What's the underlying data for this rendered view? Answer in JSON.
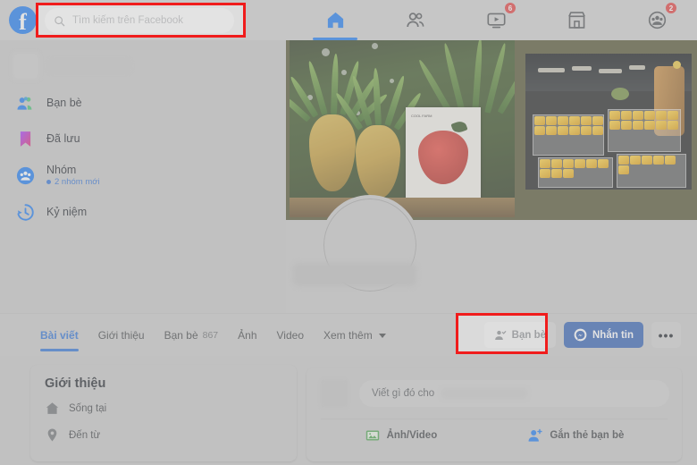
{
  "app": {
    "name": "Facebook",
    "logo_letter": "f",
    "brand_color": "#1877f2"
  },
  "topbar": {
    "search": {
      "placeholder": "Tìm kiếm trên Facebook",
      "value": "",
      "icon": "search-icon"
    },
    "nav": [
      {
        "name": "home",
        "icon": "home-icon",
        "active": true,
        "badge": ""
      },
      {
        "name": "friends",
        "icon": "friends-icon",
        "active": false,
        "badge": ""
      },
      {
        "name": "watch",
        "icon": "watch-icon",
        "active": false,
        "badge": "6"
      },
      {
        "name": "marketplace",
        "icon": "marketplace-icon",
        "active": false,
        "badge": ""
      },
      {
        "name": "groups",
        "icon": "groups-icon",
        "active": false,
        "badge": "2"
      }
    ]
  },
  "sidebar": {
    "profile": {
      "name_redacted": true
    },
    "items": [
      {
        "label": "Bạn bè",
        "icon": "friends-icon",
        "sub": ""
      },
      {
        "label": "Đã lưu",
        "icon": "bookmark-icon",
        "sub": ""
      },
      {
        "label": "Nhóm",
        "icon": "groups-icon",
        "sub": "2 nhóm mới"
      },
      {
        "label": "Kỷ niệm",
        "icon": "clock-icon",
        "sub": ""
      }
    ]
  },
  "cover": {
    "description": "Ảnh bìa"
  },
  "profile": {
    "name_redacted": true
  },
  "tabs": [
    {
      "label": "Bài viết",
      "count": "",
      "active": true
    },
    {
      "label": "Giới thiệu",
      "count": "",
      "active": false
    },
    {
      "label": "Bạn bè",
      "count": "867",
      "active": false
    },
    {
      "label": "Ảnh",
      "count": "",
      "active": false
    },
    {
      "label": "Video",
      "count": "",
      "active": false
    },
    {
      "label": "Xem thêm",
      "count": "",
      "active": false,
      "caret": true
    }
  ],
  "actions": {
    "friends_button": {
      "label": "Bạn bè",
      "icon": "person-check-icon"
    },
    "message_button": {
      "label": "Nhắn tin",
      "icon": "messenger-icon"
    },
    "more_button": {
      "label": "•••",
      "icon": "ellipsis-icon"
    }
  },
  "intro_card": {
    "title": "Giới thiệu",
    "rows": [
      {
        "label": "Sống tại",
        "icon": "home-icon"
      },
      {
        "label": "Đến từ",
        "icon": "location-pin-icon"
      }
    ]
  },
  "composer": {
    "placeholder_prefix": "Viết gì đó cho",
    "placeholder_suffix": "…",
    "actions": [
      {
        "label": "Ảnh/Video",
        "icon": "photo-video-icon",
        "color": "#45a049"
      },
      {
        "label": "Gắn thẻ bạn bè",
        "icon": "tag-friend-icon",
        "color": "#1877f2"
      }
    ]
  },
  "highlights": [
    {
      "name": "search-bar-highlight",
      "color": "#f01c1c"
    },
    {
      "name": "friends-button-highlight",
      "color": "#f01c1c"
    }
  ]
}
